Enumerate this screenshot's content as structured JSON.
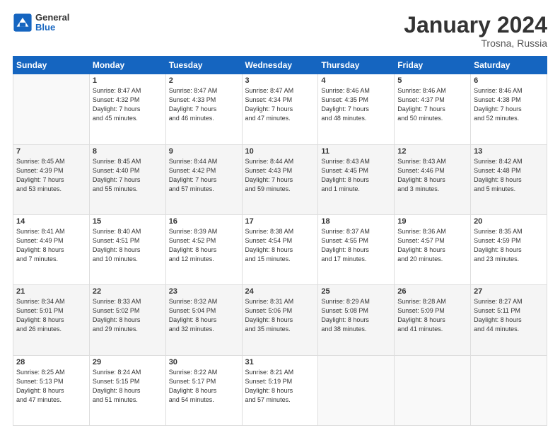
{
  "logo": {
    "general": "General",
    "blue": "Blue"
  },
  "header": {
    "month": "January 2024",
    "location": "Trosna, Russia"
  },
  "weekdays": [
    "Sunday",
    "Monday",
    "Tuesday",
    "Wednesday",
    "Thursday",
    "Friday",
    "Saturday"
  ],
  "weeks": [
    [
      {
        "day": "",
        "info": ""
      },
      {
        "day": "1",
        "info": "Sunrise: 8:47 AM\nSunset: 4:32 PM\nDaylight: 7 hours\nand 45 minutes."
      },
      {
        "day": "2",
        "info": "Sunrise: 8:47 AM\nSunset: 4:33 PM\nDaylight: 7 hours\nand 46 minutes."
      },
      {
        "day": "3",
        "info": "Sunrise: 8:47 AM\nSunset: 4:34 PM\nDaylight: 7 hours\nand 47 minutes."
      },
      {
        "day": "4",
        "info": "Sunrise: 8:46 AM\nSunset: 4:35 PM\nDaylight: 7 hours\nand 48 minutes."
      },
      {
        "day": "5",
        "info": "Sunrise: 8:46 AM\nSunset: 4:37 PM\nDaylight: 7 hours\nand 50 minutes."
      },
      {
        "day": "6",
        "info": "Sunrise: 8:46 AM\nSunset: 4:38 PM\nDaylight: 7 hours\nand 52 minutes."
      }
    ],
    [
      {
        "day": "7",
        "info": "Sunrise: 8:45 AM\nSunset: 4:39 PM\nDaylight: 7 hours\nand 53 minutes."
      },
      {
        "day": "8",
        "info": "Sunrise: 8:45 AM\nSunset: 4:40 PM\nDaylight: 7 hours\nand 55 minutes."
      },
      {
        "day": "9",
        "info": "Sunrise: 8:44 AM\nSunset: 4:42 PM\nDaylight: 7 hours\nand 57 minutes."
      },
      {
        "day": "10",
        "info": "Sunrise: 8:44 AM\nSunset: 4:43 PM\nDaylight: 7 hours\nand 59 minutes."
      },
      {
        "day": "11",
        "info": "Sunrise: 8:43 AM\nSunset: 4:45 PM\nDaylight: 8 hours\nand 1 minute."
      },
      {
        "day": "12",
        "info": "Sunrise: 8:43 AM\nSunset: 4:46 PM\nDaylight: 8 hours\nand 3 minutes."
      },
      {
        "day": "13",
        "info": "Sunrise: 8:42 AM\nSunset: 4:48 PM\nDaylight: 8 hours\nand 5 minutes."
      }
    ],
    [
      {
        "day": "14",
        "info": "Sunrise: 8:41 AM\nSunset: 4:49 PM\nDaylight: 8 hours\nand 7 minutes."
      },
      {
        "day": "15",
        "info": "Sunrise: 8:40 AM\nSunset: 4:51 PM\nDaylight: 8 hours\nand 10 minutes."
      },
      {
        "day": "16",
        "info": "Sunrise: 8:39 AM\nSunset: 4:52 PM\nDaylight: 8 hours\nand 12 minutes."
      },
      {
        "day": "17",
        "info": "Sunrise: 8:38 AM\nSunset: 4:54 PM\nDaylight: 8 hours\nand 15 minutes."
      },
      {
        "day": "18",
        "info": "Sunrise: 8:37 AM\nSunset: 4:55 PM\nDaylight: 8 hours\nand 17 minutes."
      },
      {
        "day": "19",
        "info": "Sunrise: 8:36 AM\nSunset: 4:57 PM\nDaylight: 8 hours\nand 20 minutes."
      },
      {
        "day": "20",
        "info": "Sunrise: 8:35 AM\nSunset: 4:59 PM\nDaylight: 8 hours\nand 23 minutes."
      }
    ],
    [
      {
        "day": "21",
        "info": "Sunrise: 8:34 AM\nSunset: 5:01 PM\nDaylight: 8 hours\nand 26 minutes."
      },
      {
        "day": "22",
        "info": "Sunrise: 8:33 AM\nSunset: 5:02 PM\nDaylight: 8 hours\nand 29 minutes."
      },
      {
        "day": "23",
        "info": "Sunrise: 8:32 AM\nSunset: 5:04 PM\nDaylight: 8 hours\nand 32 minutes."
      },
      {
        "day": "24",
        "info": "Sunrise: 8:31 AM\nSunset: 5:06 PM\nDaylight: 8 hours\nand 35 minutes."
      },
      {
        "day": "25",
        "info": "Sunrise: 8:29 AM\nSunset: 5:08 PM\nDaylight: 8 hours\nand 38 minutes."
      },
      {
        "day": "26",
        "info": "Sunrise: 8:28 AM\nSunset: 5:09 PM\nDaylight: 8 hours\nand 41 minutes."
      },
      {
        "day": "27",
        "info": "Sunrise: 8:27 AM\nSunset: 5:11 PM\nDaylight: 8 hours\nand 44 minutes."
      }
    ],
    [
      {
        "day": "28",
        "info": "Sunrise: 8:25 AM\nSunset: 5:13 PM\nDaylight: 8 hours\nand 47 minutes."
      },
      {
        "day": "29",
        "info": "Sunrise: 8:24 AM\nSunset: 5:15 PM\nDaylight: 8 hours\nand 51 minutes."
      },
      {
        "day": "30",
        "info": "Sunrise: 8:22 AM\nSunset: 5:17 PM\nDaylight: 8 hours\nand 54 minutes."
      },
      {
        "day": "31",
        "info": "Sunrise: 8:21 AM\nSunset: 5:19 PM\nDaylight: 8 hours\nand 57 minutes."
      },
      {
        "day": "",
        "info": ""
      },
      {
        "day": "",
        "info": ""
      },
      {
        "day": "",
        "info": ""
      }
    ]
  ]
}
